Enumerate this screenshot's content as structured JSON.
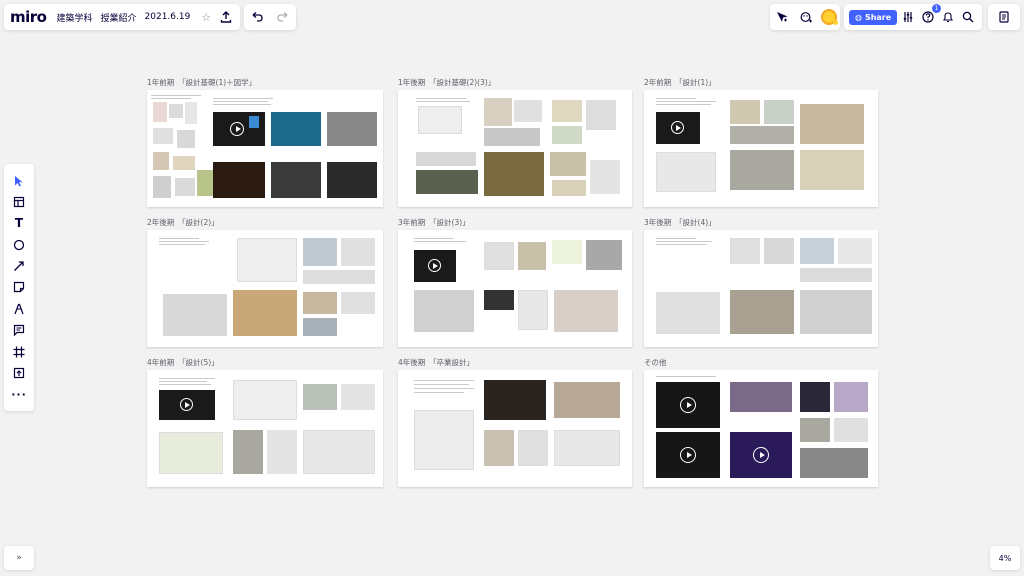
{
  "board": {
    "logo": "miro",
    "title_1": "建築学科",
    "title_2": "授業紹介",
    "date": "2021.6.19"
  },
  "share": {
    "label": "Share"
  },
  "help": {
    "badge": "1"
  },
  "zoom": {
    "level": "4%"
  },
  "expand": {
    "label": "»"
  },
  "frames": [
    {
      "label": "1年前期　「設計基礎(1)＋図学」"
    },
    {
      "label": "1年後期　「設計基礎(2)(3)」"
    },
    {
      "label": "2年前期　「設計(1)」"
    },
    {
      "label": "2年後期　「設計(2)」"
    },
    {
      "label": "3年前期　「設計(3)」"
    },
    {
      "label": "3年後期　「設計(4)」"
    },
    {
      "label": "4年前期　「設計(5)」"
    },
    {
      "label": "4年後期　「卒業設計」"
    },
    {
      "label": "その他"
    }
  ],
  "colors": {
    "accent": "#4262ff",
    "avatar": "#ffd02f",
    "canvas": "#f2f2f2"
  }
}
